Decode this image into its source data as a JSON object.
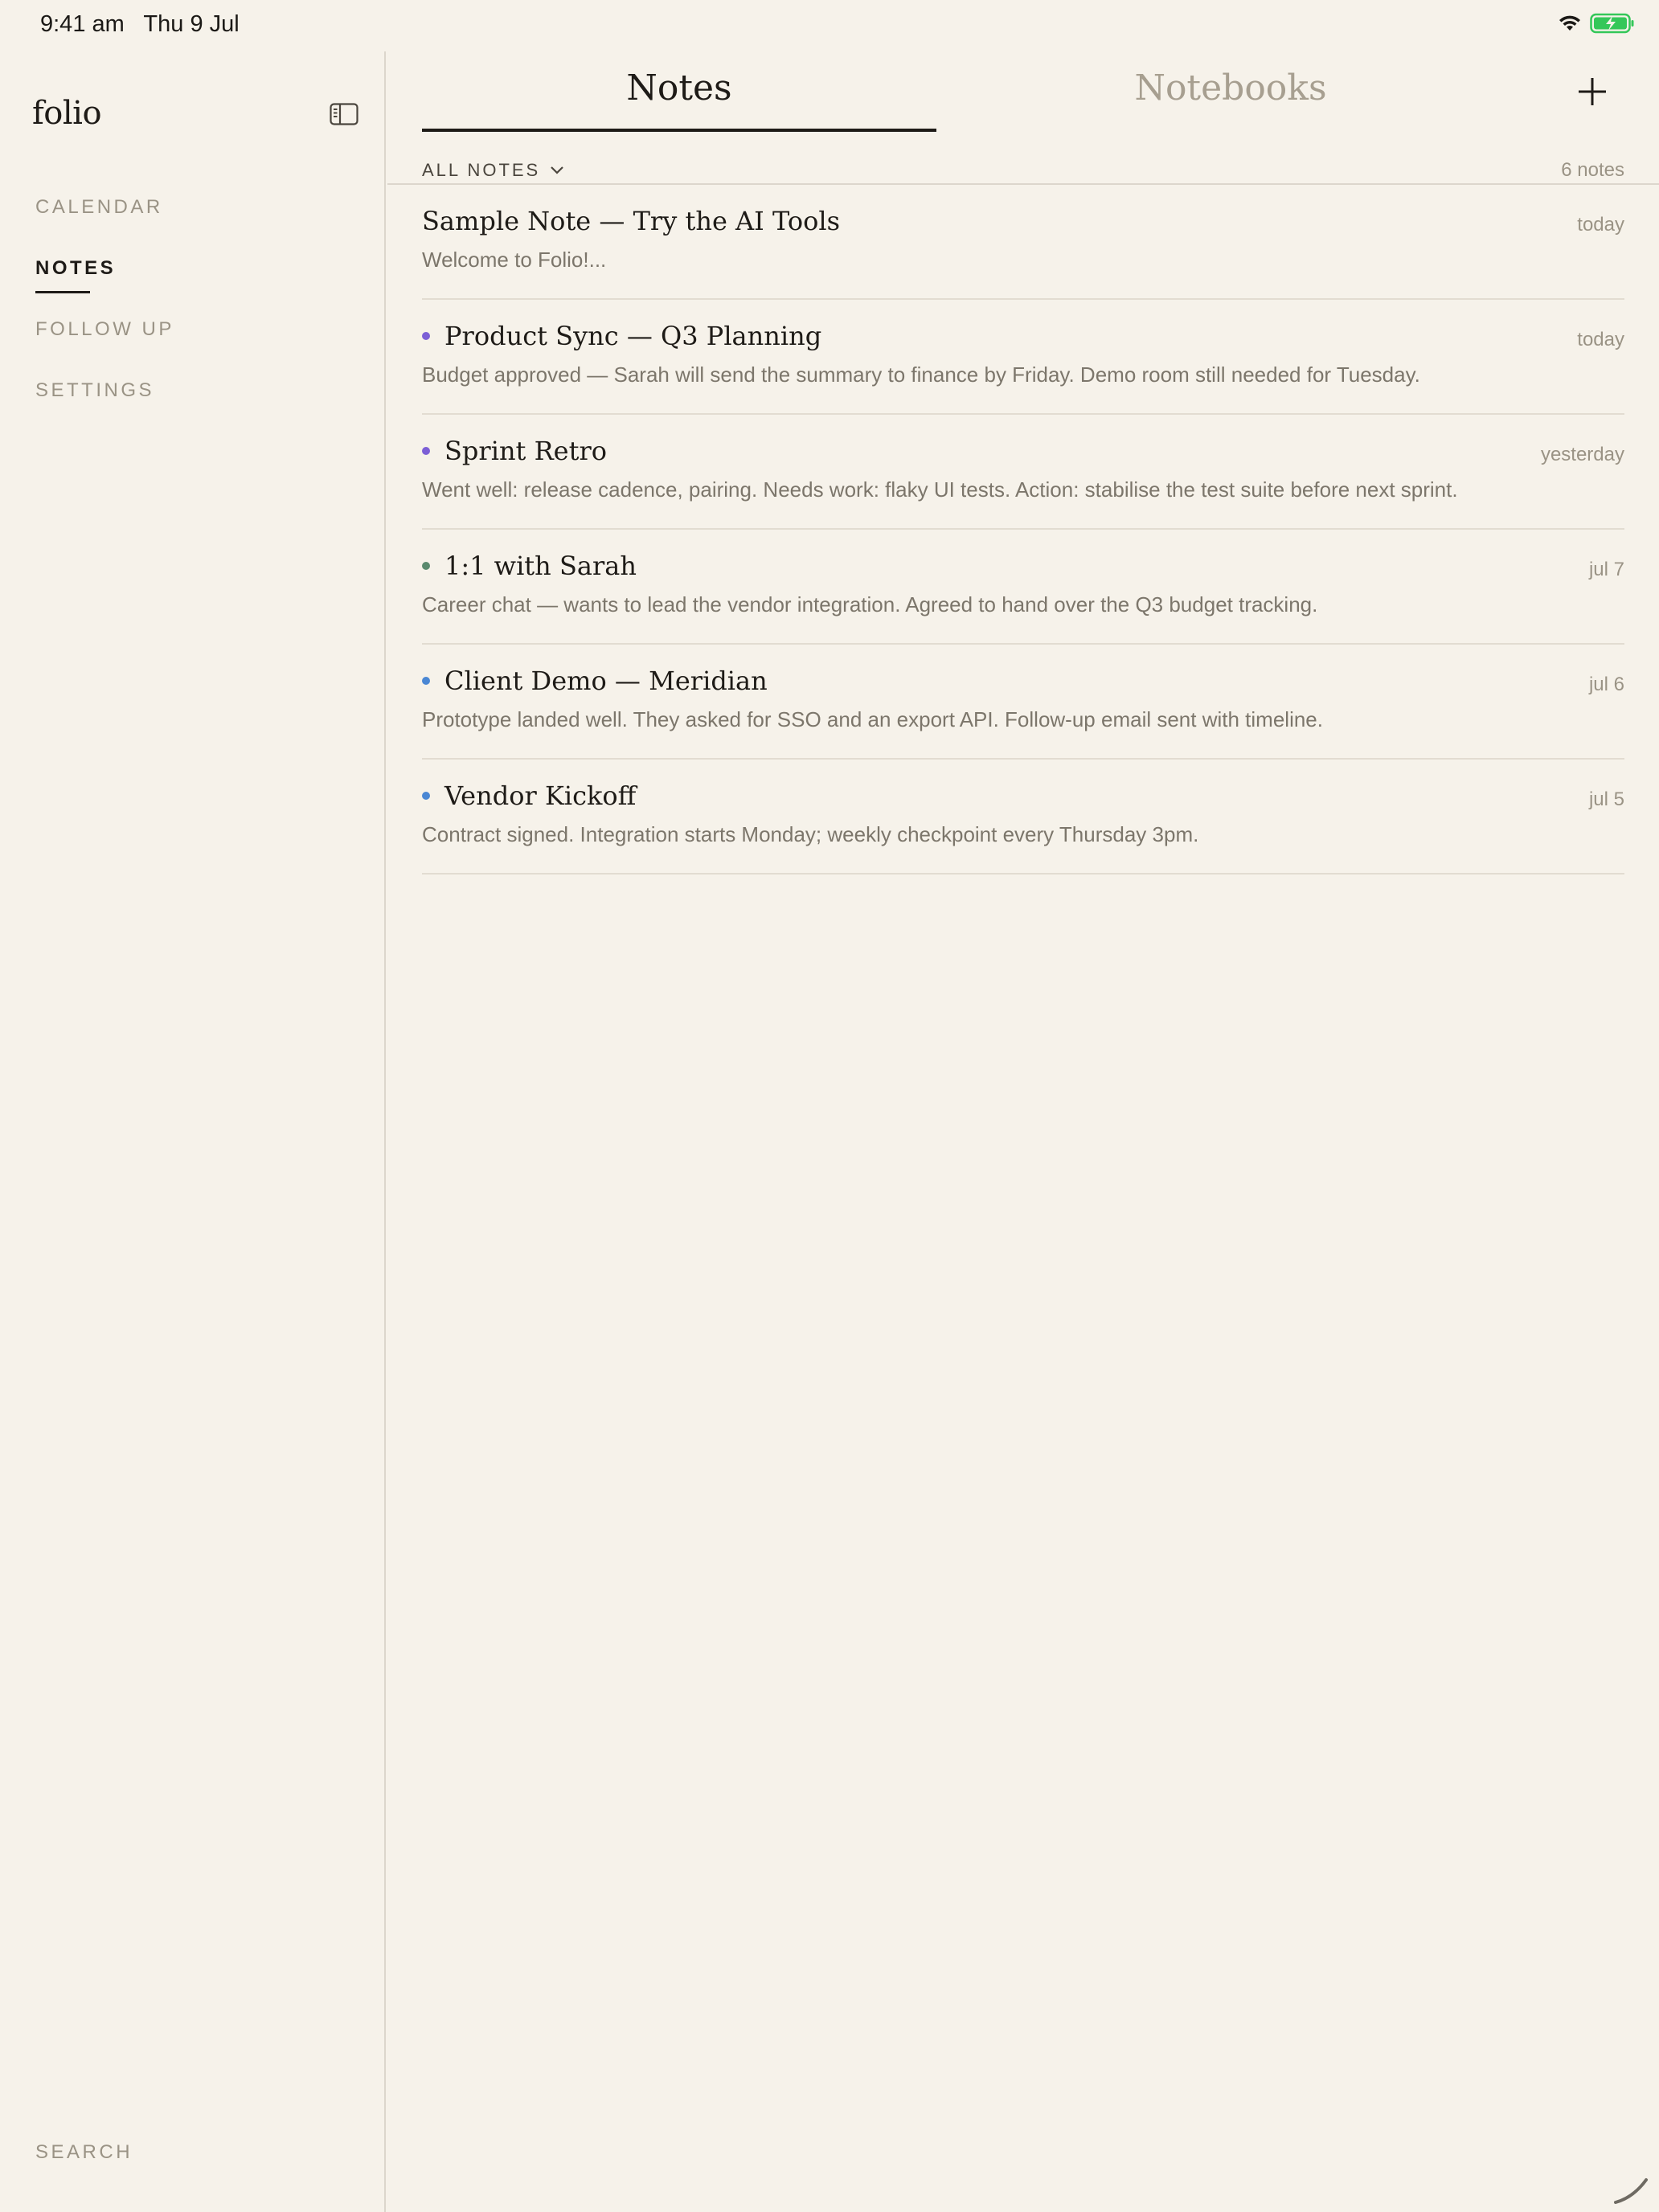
{
  "status": {
    "time": "9:41 am   Thu 9 Jul"
  },
  "sidebar": {
    "brand": "folio",
    "items": [
      {
        "label": "CALENDAR",
        "active": false
      },
      {
        "label": "NOTES",
        "active": true
      },
      {
        "label": "FOLLOW UP",
        "active": false
      },
      {
        "label": "SETTINGS",
        "active": false
      }
    ],
    "search_label": "SEARCH"
  },
  "main": {
    "tabs": [
      {
        "label": "Notes",
        "active": true
      },
      {
        "label": "Notebooks",
        "active": false
      }
    ],
    "filter_label": "ALL NOTES",
    "count": "6 notes",
    "notes": [
      {
        "title": "Sample Note — Try the AI Tools",
        "date": "today",
        "preview": "Welcome to Folio!...",
        "dot": null
      },
      {
        "title": "Product Sync — Q3 Planning",
        "date": "today",
        "preview": "Budget approved — Sarah will send the summary to finance by Friday. Demo room still needed for Tuesday.",
        "dot": "#7c5fd6"
      },
      {
        "title": "Sprint Retro",
        "date": "yesterday",
        "preview": "Went well: release cadence, pairing. Needs work: flaky UI tests. Action: stabilise the test suite before next sprint.",
        "dot": "#7c5fd6"
      },
      {
        "title": "1:1 with Sarah",
        "date": "jul 7",
        "preview": "Career chat — wants to lead the vendor integration. Agreed to hand over the Q3 budget tracking.",
        "dot": "#5a8a6e"
      },
      {
        "title": "Client Demo — Meridian",
        "date": "jul 6",
        "preview": "Prototype landed well. They asked for SSO and an export API. Follow-up email sent with timeline.",
        "dot": "#4a87d4"
      },
      {
        "title": "Vendor Kickoff",
        "date": "jul 5",
        "preview": "Contract signed. Integration starts Monday; weekly checkpoint every Thursday 3pm.",
        "dot": "#4a87d4"
      }
    ]
  },
  "icons": {
    "sidebar_toggle": "sidebar-toggle-icon",
    "add": "plus-icon",
    "chevron": "chevron-down-icon",
    "wifi": "wifi-icon",
    "battery": "battery-charging-icon",
    "pencil": "pencil-icon"
  },
  "colors": {
    "background": "#f6f2ea",
    "battery": "#34c759"
  }
}
